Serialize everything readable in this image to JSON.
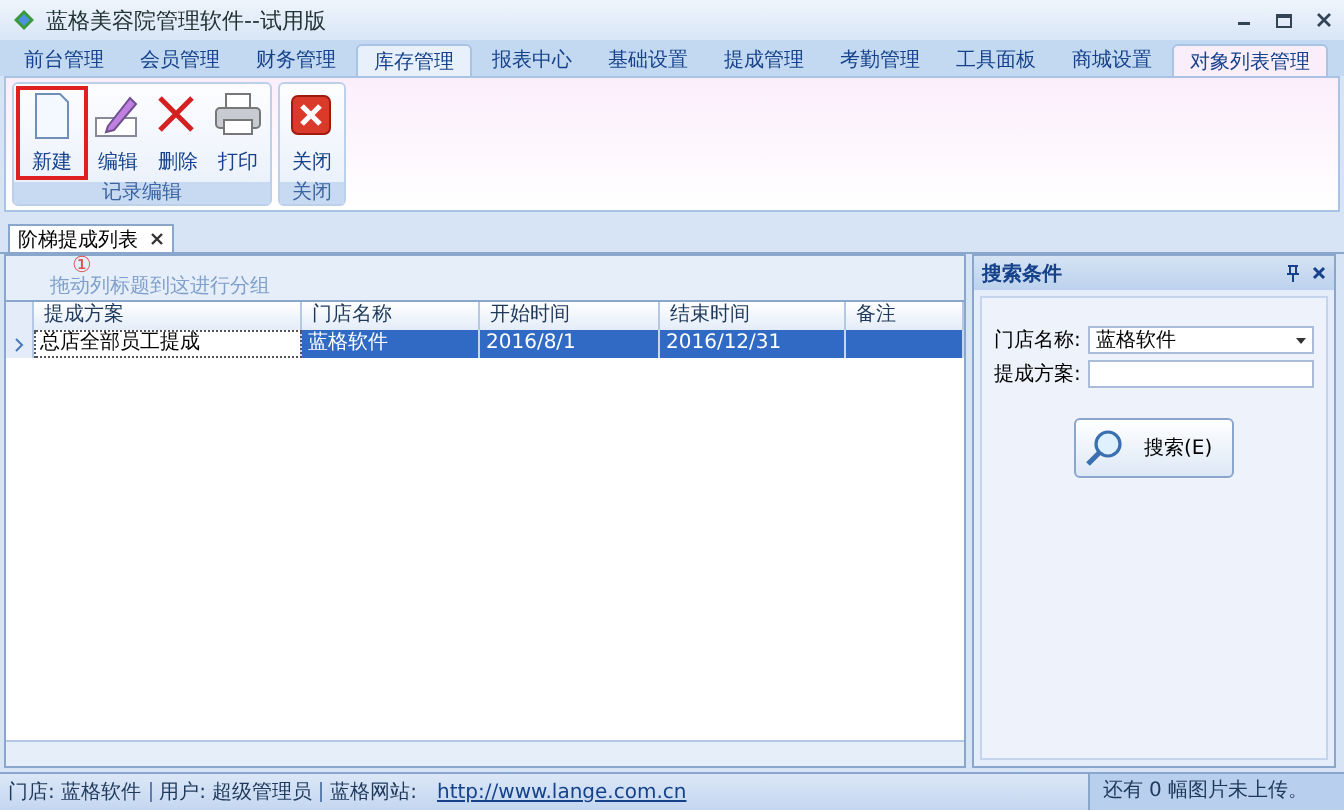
{
  "window": {
    "title": "蓝格美容院管理软件--试用版"
  },
  "tabs": [
    {
      "label": "前台管理",
      "selected": false,
      "highlighted": false
    },
    {
      "label": "会员管理",
      "selected": false,
      "highlighted": false
    },
    {
      "label": "财务管理",
      "selected": false,
      "highlighted": false
    },
    {
      "label": "库存管理",
      "selected": false,
      "highlighted": true
    },
    {
      "label": "报表中心",
      "selected": false,
      "highlighted": false
    },
    {
      "label": "基础设置",
      "selected": false,
      "highlighted": false
    },
    {
      "label": "提成管理",
      "selected": false,
      "highlighted": false
    },
    {
      "label": "考勤管理",
      "selected": false,
      "highlighted": false
    },
    {
      "label": "工具面板",
      "selected": false,
      "highlighted": false
    },
    {
      "label": "商城设置",
      "selected": false,
      "highlighted": false
    },
    {
      "label": "对象列表管理",
      "selected": true,
      "highlighted": false
    }
  ],
  "ribbon_groups": [
    {
      "label": "记录编辑",
      "buttons": [
        {
          "label": "新建",
          "kind": "new",
          "marked": true
        },
        {
          "label": "编辑",
          "kind": "edit",
          "marked": false
        },
        {
          "label": "删除",
          "kind": "delete",
          "marked": false
        },
        {
          "label": "打印",
          "kind": "print",
          "marked": false
        }
      ]
    },
    {
      "label": "关闭",
      "buttons": [
        {
          "label": "关闭",
          "kind": "close",
          "marked": false
        }
      ]
    }
  ],
  "document_tabs": [
    {
      "label": "阶梯提成列表",
      "selected": true
    }
  ],
  "annotation": "①",
  "grid": {
    "group_hint": "拖动列标题到这进行分组",
    "columns": [
      "提成方案",
      "门店名称",
      "开始时间",
      "结束时间",
      "备注"
    ],
    "rows": [
      {
        "cells": [
          "总店全部员工提成",
          "蓝格软件",
          "2016/8/1",
          "2016/12/31",
          null
        ],
        "selected": true
      }
    ]
  },
  "search_panel": {
    "title": "搜索条件",
    "fields": [
      {
        "label": "门店名称:",
        "value": "蓝格软件",
        "kind": "dropdown"
      },
      {
        "label": "提成方案:",
        "kind": "text"
      }
    ],
    "button": "搜索(E)"
  },
  "status_bar": {
    "items": [
      "门店: 蓝格软件",
      "用户: 超级管理员",
      "蓝格网站:"
    ],
    "link": "http://www.lange.com.cn",
    "right": "还有 0 幅图片未上传。"
  }
}
